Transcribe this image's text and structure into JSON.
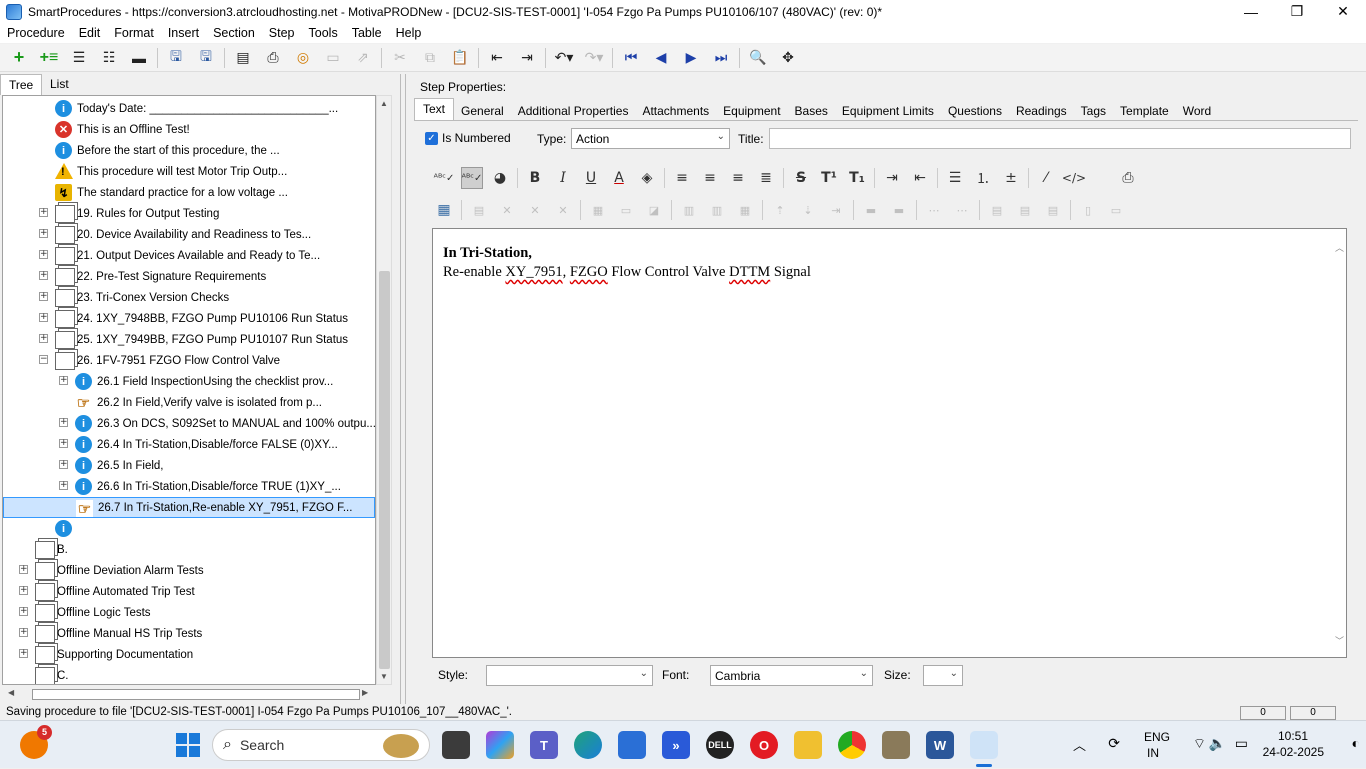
{
  "window": {
    "title": "SmartProcedures - https://conversion3.atrcloudhosting.net - MotivaPRODNew - [DCU2-SIS-TEST-0001] 'I-054 Fzgo Pa Pumps PU10106/107 (480VAC)' (rev: 0)*",
    "minimize": "—",
    "maximize": "❐",
    "close": "✕"
  },
  "menu": [
    "Procedure",
    "Edit",
    "Format",
    "Insert",
    "Section",
    "Step",
    "Tools",
    "Table",
    "Help"
  ],
  "left_tabs": {
    "tree": "Tree",
    "list": "List"
  },
  "tree": [
    {
      "label": "Today's Date: ____________________________...",
      "icon": "info",
      "indent": 2,
      "expander": ""
    },
    {
      "label": "This is an Offline Test!",
      "icon": "err",
      "indent": 2,
      "expander": ""
    },
    {
      "label": "Before the start of this procedure, the ...",
      "icon": "info",
      "indent": 2,
      "expander": ""
    },
    {
      "label": "This procedure will test Motor Trip Outp...",
      "icon": "warn",
      "indent": 2,
      "expander": ""
    },
    {
      "label": "The standard practice for a low voltage ...",
      "icon": "volt",
      "indent": 2,
      "expander": ""
    },
    {
      "label": "19. Rules for Output Testing",
      "icon": "doc",
      "indent": 2,
      "expander": "+"
    },
    {
      "label": "20. Device Availability and Readiness to Tes...",
      "icon": "doc",
      "indent": 2,
      "expander": "+"
    },
    {
      "label": "21. Output Devices Available and Ready to Te...",
      "icon": "doc",
      "indent": 2,
      "expander": "+"
    },
    {
      "label": "22. Pre-Test Signature Requirements",
      "icon": "doc",
      "indent": 2,
      "expander": "+"
    },
    {
      "label": "23. Tri-Conex Version Checks",
      "icon": "doc",
      "indent": 2,
      "expander": "+"
    },
    {
      "label": "24. 1XY_7948BB, FZGO Pump PU10106 Run Status",
      "icon": "doc",
      "indent": 2,
      "expander": "+"
    },
    {
      "label": "25. 1XY_7949BB, FZGO Pump PU10107 Run Status",
      "icon": "doc",
      "indent": 2,
      "expander": "+"
    },
    {
      "label": "26. 1FV-7951 FZGO Flow Control Valve",
      "icon": "doc",
      "indent": 2,
      "expander": "−"
    },
    {
      "label": "26.1 Field InspectionUsing the checklist prov...",
      "icon": "info",
      "indent": 3,
      "expander": "+"
    },
    {
      "label": "26.2 In Field,Verify valve is isolated from p...",
      "icon": "hand",
      "indent": 3,
      "expander": ""
    },
    {
      "label": "26.3 On DCS, S092Set to MANUAL and 100% outpu...",
      "icon": "info",
      "indent": 3,
      "expander": "+"
    },
    {
      "label": "26.4 In Tri-Station,Disable/force FALSE (0)XY...",
      "icon": "info",
      "indent": 3,
      "expander": "+"
    },
    {
      "label": "26.5 In Field,",
      "icon": "info",
      "indent": 3,
      "expander": "+"
    },
    {
      "label": "26.6 In Tri-Station,Disable/force TRUE (1)XY_...",
      "icon": "info",
      "indent": 3,
      "expander": "+"
    },
    {
      "label": "26.7 In Tri-Station,Re-enable XY_7951, FZGO F...",
      "icon": "hand",
      "indent": 3,
      "expander": "",
      "selected": true
    },
    {
      "label": "",
      "icon": "info",
      "indent": 2,
      "expander": ""
    },
    {
      "label": "B.",
      "icon": "doc",
      "indent": 1,
      "expander": ""
    },
    {
      "label": "Offline Deviation Alarm Tests",
      "icon": "doc",
      "indent": 1,
      "expander": "+"
    },
    {
      "label": "Offline Automated Trip Test",
      "icon": "doc",
      "indent": 1,
      "expander": "+"
    },
    {
      "label": "Offline Logic Tests",
      "icon": "doc",
      "indent": 1,
      "expander": "+"
    },
    {
      "label": "Offline Manual HS Trip Tests",
      "icon": "doc",
      "indent": 1,
      "expander": "+"
    },
    {
      "label": "Supporting Documentation",
      "icon": "doc",
      "indent": 1,
      "expander": "+"
    },
    {
      "label": "C.",
      "icon": "doc",
      "indent": 1,
      "expander": ""
    }
  ],
  "step_props": {
    "heading": "Step Properties:",
    "tabs": [
      "Text",
      "General",
      "Additional Properties",
      "Attachments",
      "Equipment",
      "Bases",
      "Equipment Limits",
      "Questions",
      "Readings",
      "Tags",
      "Template",
      "Word"
    ],
    "is_numbered_label": "Is Numbered",
    "is_numbered_checked": true,
    "type_label": "Type:",
    "type_value": "Action",
    "title_label": "Title:",
    "title_value": ""
  },
  "editor": {
    "line1": "In Tri-Station,",
    "line2_parts": [
      "Re-enable ",
      "XY_7951",
      ", ",
      "FZGO",
      " Flow Control Valve ",
      "DTTM",
      " Signal"
    ]
  },
  "bottom": {
    "style_label": "Style:",
    "style_value": "",
    "font_label": "Font:",
    "font_value": "Cambria",
    "size_label": "Size:",
    "size_value": ""
  },
  "status": {
    "text": "Saving procedure to file '[DCU2-SIS-TEST-0001] I-054 Fzgo Pa Pumps PU10106_107__480VAC_'.",
    "pane1": "0",
    "pane2": "0"
  },
  "taskbar": {
    "search_text": "Search",
    "badge": "5",
    "lang_top": "ENG",
    "lang_bottom": "IN",
    "time": "10:51",
    "date": "24-02-2025"
  }
}
